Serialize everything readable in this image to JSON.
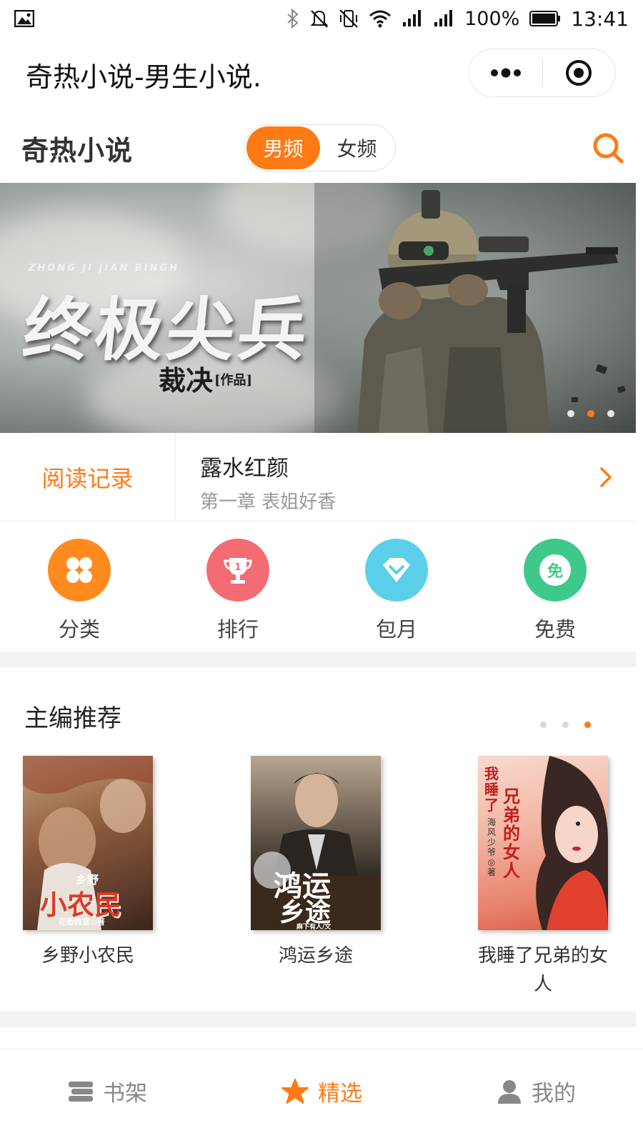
{
  "status_bar": {
    "battery": "100%",
    "time": "13:41",
    "icons": [
      "image-icon",
      "bluetooth-icon",
      "mute-icon",
      "vibrate-off-icon",
      "wifi-icon",
      "signal-icon",
      "signal-icon",
      "battery-icon"
    ]
  },
  "mp_header": {
    "title": "奇热小说-男生小说."
  },
  "app_header": {
    "logo": "奇热小说",
    "tabs": [
      {
        "label": "男频",
        "active": true
      },
      {
        "label": "女频",
        "active": false
      }
    ]
  },
  "banner": {
    "subtitle": "ZHONG JI JIAN BINGH",
    "title": "终极尖兵",
    "author": "裁决",
    "author_tag": "[作品]",
    "active_slide": 2,
    "slide_count": 3
  },
  "reading_record": {
    "label": "阅读记录",
    "book_title": "露水红颜",
    "chapter": "第一章 表姐好香"
  },
  "categories": [
    {
      "label": "分类",
      "icon": "grid-icon",
      "color": "#ff8a1e"
    },
    {
      "label": "排行",
      "icon": "trophy-icon",
      "color": "#f36b73"
    },
    {
      "label": "包月",
      "icon": "diamond-icon",
      "color": "#5bcfea"
    },
    {
      "label": "免费",
      "icon": "free-icon",
      "color": "#3ec98b",
      "icon_text": "免"
    }
  ],
  "editor_recommend": {
    "title": "主编推荐",
    "active_page": 3,
    "page_count": 3,
    "books": [
      {
        "title": "乡野小农民",
        "cover_text_1": "乡野",
        "cover_text_2": "小农民",
        "cover_author": "花街教官◎著"
      },
      {
        "title": "鸿运乡途",
        "cover_text_1": "鸿运",
        "cover_text_2": "乡途",
        "cover_author": "麻下有人/文"
      },
      {
        "title": "我睡了兄弟的女人",
        "cover_text_1": "我睡了",
        "cover_text_2": "兄弟的女人",
        "cover_author": "海风少爷◎著"
      }
    ]
  },
  "tabbar": {
    "items": [
      {
        "label": "书架",
        "icon": "bookshelf-icon",
        "active": false
      },
      {
        "label": "精选",
        "icon": "star-icon",
        "active": true
      },
      {
        "label": "我的",
        "icon": "user-icon",
        "active": false
      }
    ]
  },
  "colors": {
    "accent": "#ff7a14",
    "text": "#222222",
    "muted": "#999999"
  }
}
